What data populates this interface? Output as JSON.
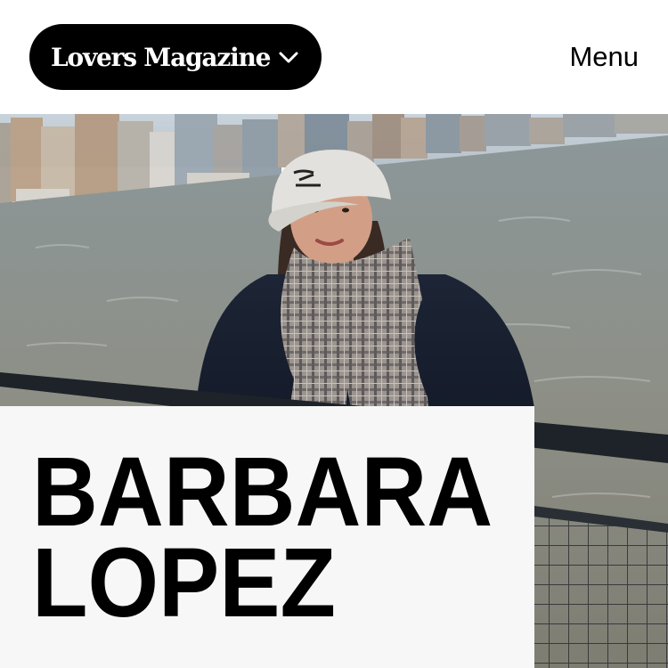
{
  "header": {
    "brand": "Lovers Magazine",
    "brand_dropdown_icon": "chevron-down-icon",
    "menu_label": "Menu"
  },
  "hero": {
    "image_subject": "portrait photo of a person in a cap and scarf on a ferry in front of a city skyline"
  },
  "profile": {
    "first_name": "BARBARA",
    "last_name": "LOPEZ"
  },
  "colors": {
    "brand_pill": "#000000",
    "brand_text": "#ffffff",
    "name_card_bg": "#f7f7f7",
    "page_bg": "#ffffff"
  }
}
